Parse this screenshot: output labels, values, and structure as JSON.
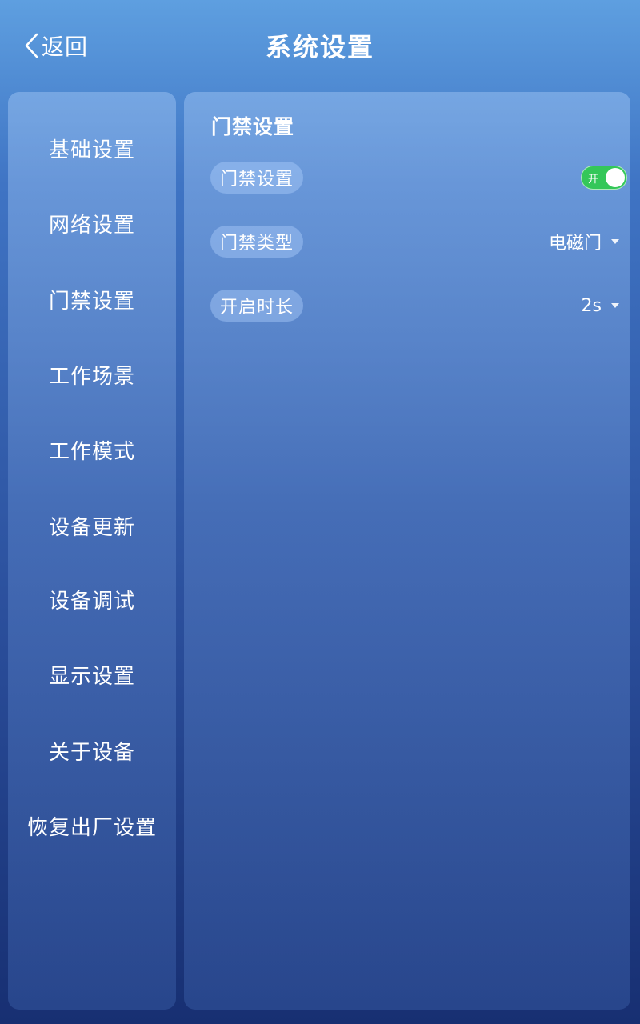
{
  "header": {
    "back_label": "返回",
    "title": "系统设置"
  },
  "sidebar": {
    "items": [
      {
        "label": "基础设置"
      },
      {
        "label": "网络设置"
      },
      {
        "label": "门禁设置"
      },
      {
        "label": "工作场景"
      },
      {
        "label": "工作模式"
      },
      {
        "label": "设备更新"
      },
      {
        "label": "设备调试"
      },
      {
        "label": "显示设置"
      },
      {
        "label": "关于设备"
      },
      {
        "label": "恢复出厂设置"
      }
    ]
  },
  "panel": {
    "title": "门禁设置",
    "rows": [
      {
        "label": "门禁设置",
        "toggle_text": "开",
        "enabled": true
      },
      {
        "label": "门禁类型",
        "value": "电磁门"
      },
      {
        "label": "开启时长",
        "value": "2s"
      }
    ]
  },
  "colors": {
    "toggle_on": "#34c759",
    "background_top": "#5e9fe0",
    "background_bottom": "#172f72"
  }
}
